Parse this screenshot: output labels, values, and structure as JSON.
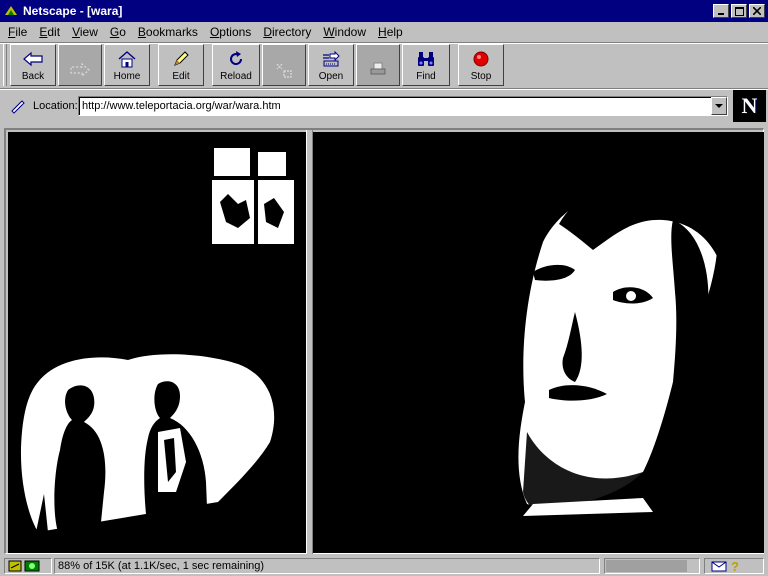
{
  "window": {
    "title": "Netscape - [wara]",
    "app_icon": "netscape-icon",
    "controls": [
      "minimize-icon",
      "maximize-icon",
      "close-icon"
    ]
  },
  "menu": {
    "items": [
      {
        "label": "File"
      },
      {
        "label": "Edit"
      },
      {
        "label": "View"
      },
      {
        "label": "Go"
      },
      {
        "label": "Bookmarks"
      },
      {
        "label": "Options"
      },
      {
        "label": "Directory"
      },
      {
        "label": "Window"
      },
      {
        "label": "Help"
      }
    ]
  },
  "toolbar": {
    "back": {
      "label": "Back",
      "icon": "back-arrow-icon"
    },
    "forward": {
      "label": "",
      "icon": "forward-arrow-icon"
    },
    "home": {
      "label": "Home",
      "icon": "home-icon"
    },
    "edit": {
      "label": "Edit",
      "icon": "pencil-icon"
    },
    "reload": {
      "label": "Reload",
      "icon": "reload-icon"
    },
    "images": {
      "label": "",
      "icon": "images-icon"
    },
    "open": {
      "label": "Open",
      "icon": "open-icon"
    },
    "print": {
      "label": "",
      "icon": "print-icon"
    },
    "find": {
      "label": "Find",
      "icon": "binoculars-icon"
    },
    "stop": {
      "label": "Stop",
      "icon": "stop-icon"
    }
  },
  "location": {
    "label": "Location:",
    "url": "http://www.teleportacia.org/war/wara.htm",
    "icon": "bookmark-icon"
  },
  "branding": {
    "logo_letter": "N"
  },
  "status": {
    "text": "88% of 15K (at 1.1K/sec, 1 sec remaining)",
    "progress": 0.88,
    "icons": [
      "security-key-icon",
      "mail-icon",
      "help-icon"
    ]
  },
  "colors": {
    "titlebar": "#000080",
    "chrome": "#c0c0c0",
    "frame_bg": "#000000",
    "stop_red": "#e00000"
  }
}
